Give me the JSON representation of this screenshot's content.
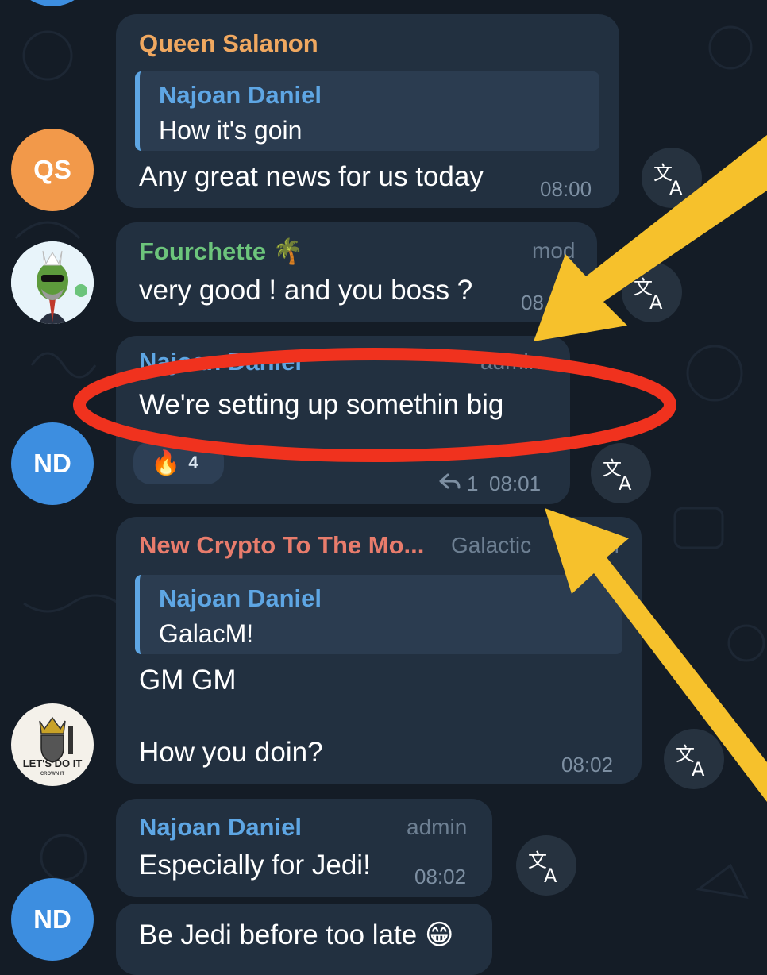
{
  "messages": [
    {
      "id": "m1",
      "avatar_initials": "QS",
      "sender": "Queen Salanon",
      "reply_to": {
        "name": "Najoan Daniel",
        "text": "How it's goin"
      },
      "text": "Any great news for us today",
      "time": "08:00",
      "colors": {
        "name": "#f0a860",
        "avatar": "#f2994a"
      }
    },
    {
      "id": "m2",
      "sender": "Fourchette 🌴",
      "role": "mod",
      "text": "very good ! and you boss ?",
      "time": "08",
      "colors": {
        "name": "#6cc47b"
      }
    },
    {
      "id": "m3",
      "avatar_initials": "ND",
      "sender": "Najoan Daniel",
      "role": "admin",
      "text": "We're setting up somethin big",
      "reaction": {
        "emoji": "🔥",
        "count": "4"
      },
      "reply_count": "1",
      "time": "08:01",
      "colors": {
        "name": "#5ea6e4",
        "avatar": "#3d8ee0"
      }
    },
    {
      "id": "m4",
      "sender": "New Crypto To The Mo...",
      "role": "Galactic",
      "role_tail": "er",
      "reply_to": {
        "name": "Najoan Daniel",
        "text": "GalacM!"
      },
      "text_line1": "GM GM",
      "text_line2": "How you doin?",
      "avatar_label": "LET'S DO IT",
      "avatar_sub": "CROWN IT",
      "time": "08:02",
      "colors": {
        "name": "#e87c6c"
      }
    },
    {
      "id": "m5",
      "sender": "Najoan Daniel",
      "role": "admin",
      "text": "Especially for Jedi!",
      "time": "08:02",
      "colors": {
        "name": "#5ea6e4"
      }
    },
    {
      "id": "m6",
      "avatar_initials": "ND",
      "text": "Be Jedi before too late 😁",
      "colors": {
        "avatar": "#3d8ee0"
      }
    }
  ],
  "icons": {
    "translate": "translate-icon",
    "reply": "reply-arrow-icon",
    "fire": "fire-emoji"
  },
  "annotation_colors": {
    "arrow": "#f6c12c",
    "circle": "#f0321e"
  }
}
